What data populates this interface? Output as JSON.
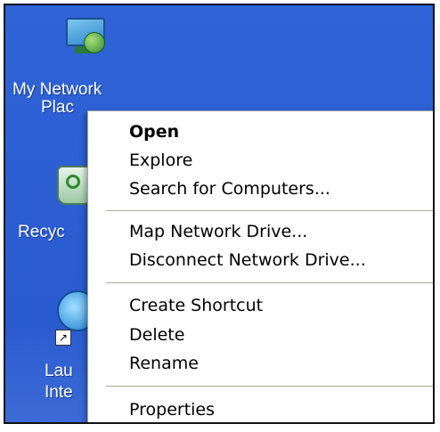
{
  "desktop": {
    "icons": [
      {
        "name": "network-places",
        "label_line1": "My Network",
        "label_line2": "Plac"
      },
      {
        "name": "recycle-bin",
        "label": "Recyc"
      },
      {
        "name": "internet-explorer",
        "label_line1": "Lau",
        "label_line2": "Inte",
        "shortcut_glyph": "↗"
      }
    ]
  },
  "context_menu": {
    "items": [
      {
        "label": "Open",
        "bold": true
      },
      {
        "label": "Explore"
      },
      {
        "label": "Search for Computers..."
      },
      {
        "separator": true
      },
      {
        "label": "Map Network Drive..."
      },
      {
        "label": "Disconnect Network Drive..."
      },
      {
        "separator": true
      },
      {
        "label": "Create Shortcut"
      },
      {
        "label": "Delete"
      },
      {
        "label": "Rename"
      },
      {
        "separator": true
      },
      {
        "label": "Properties"
      }
    ]
  },
  "colors": {
    "desktop_blue": "#2c5fd3",
    "menu_background": "#ffffff",
    "separator": "#aca899"
  }
}
